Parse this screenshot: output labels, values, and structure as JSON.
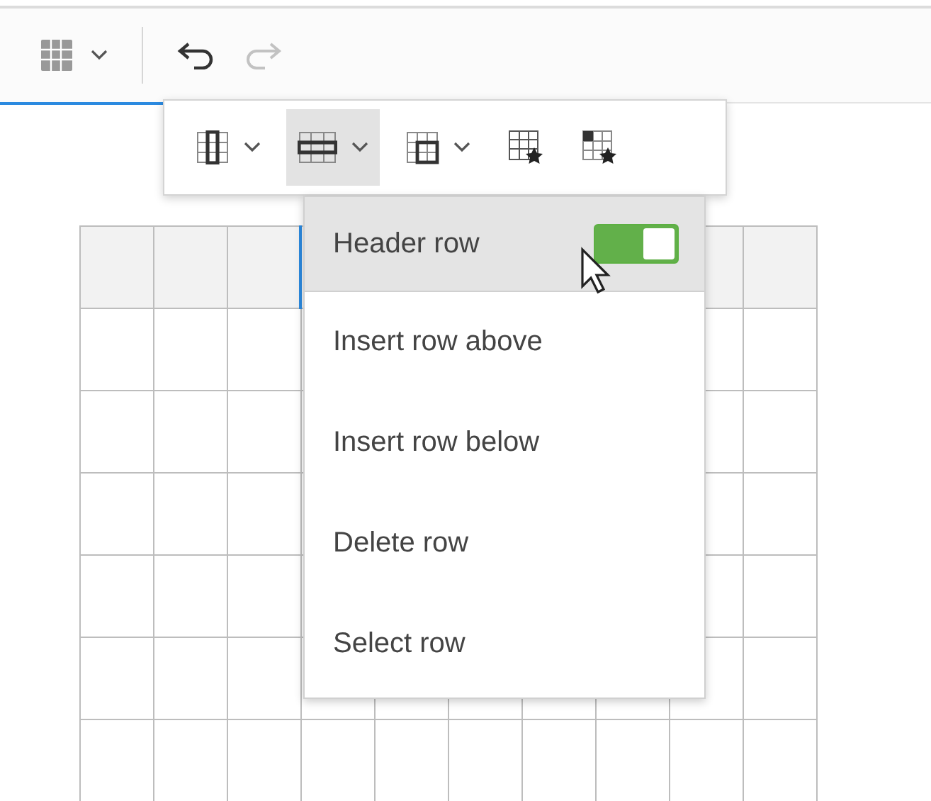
{
  "toolbar": {
    "buttons": [
      {
        "kind": "table",
        "dropdown": true,
        "disabled": false
      },
      {
        "kind": "undo",
        "dropdown": false,
        "disabled": false
      },
      {
        "kind": "redo",
        "dropdown": false,
        "disabled": true
      }
    ]
  },
  "table_toolbar": {
    "buttons": [
      {
        "kind": "column",
        "dropdown": true,
        "selected": false
      },
      {
        "kind": "row",
        "dropdown": true,
        "selected": true
      },
      {
        "kind": "cell",
        "dropdown": true,
        "selected": false
      },
      {
        "kind": "table-props",
        "dropdown": false,
        "selected": false
      },
      {
        "kind": "cell-props",
        "dropdown": false,
        "selected": false
      }
    ]
  },
  "row_menu": {
    "items": [
      {
        "label": "Header row",
        "kind": "toggle",
        "on": true,
        "selected": true
      },
      {
        "label": "Insert row above",
        "kind": "action",
        "selected": false
      },
      {
        "label": "Insert row below",
        "kind": "action",
        "selected": false
      },
      {
        "label": "Delete row",
        "kind": "action",
        "selected": false
      },
      {
        "label": "Select row",
        "kind": "action",
        "selected": false
      }
    ]
  }
}
